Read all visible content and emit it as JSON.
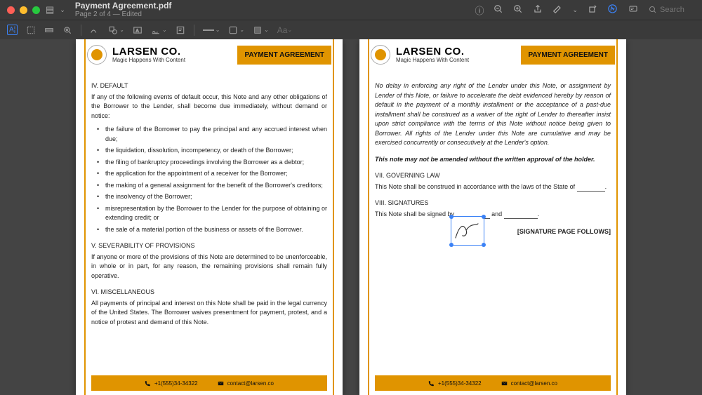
{
  "window": {
    "filename": "Payment Agreement.pdf",
    "subtitle": "Page 2 of 4 — Edited",
    "search_placeholder": "Search"
  },
  "doc": {
    "company_name": "LARSEN CO.",
    "company_tagline": "Magic Happens With Content",
    "badge": "PAYMENT AGREEMENT",
    "footer_phone": "+1(555)34-34322",
    "footer_email": "contact@larsen.co"
  },
  "page_left": {
    "s4_title": "IV. DEFAULT",
    "s4_body": "If any of the following events of default occur, this Note and any other obligations of the Borrower to the Lender, shall become due immediately, without demand or notice:",
    "bullets": [
      "the failure of the Borrower to pay the principal and any accrued interest when due;",
      "the liquidation, dissolution, incompetency, or death of the Borrower;",
      "the filing of bankruptcy proceedings involving the Borrower as a debtor;",
      "the application for the appointment of a receiver for the Borrower;",
      "the making of a general assignment for the benefit of the Borrower's creditors;",
      "the insolvency of the Borrower;",
      "misrepresentation by the Borrower to the Lender for the purpose of obtaining or extending credit; or",
      "the sale of a material portion of the business or assets of the Borrower."
    ],
    "s5_title": "V. SEVERABILITY OF PROVISIONS",
    "s5_body": "If anyone or more of the provisions of this Note are determined to be unenforceable, in whole or in part, for any reason, the remaining provisions shall remain fully operative.",
    "s6_title": "VI. MISCELLANEOUS",
    "s6_body": "All payments of principal and interest on this Note shall be paid in the legal currency of the United States. The Borrower waives presentment for payment, protest, and a notice of protest and demand of this Note."
  },
  "page_right": {
    "misc_italic": "No delay in enforcing any right of the Lender under this Note, or assignment by Lender of this Note, or failure to accelerate the debt evidenced hereby by reason of default in the payment of a monthly installment or the acceptance of a past-due installment shall be construed as a waiver of the right of Lender to thereafter insist upon strict compliance with the terms of this Note without notice being given to Borrower. All rights of the Lender under this Note are cumulative and may be exercised concurrently or consecutively at the Lender's option.",
    "amend": "This note may not be amended without the written approval of the holder.",
    "s7_title": "VII. GOVERNING LAW",
    "s7_body_a": "This Note shall be construed in accordance with the laws of the State of ",
    "s8_title": "VIII. SIGNATURES",
    "s8_body_a": "This Note shall be signed by ",
    "s8_body_b": " and ",
    "sig_follows": "[SIGNATURE PAGE FOLLOWS]"
  }
}
